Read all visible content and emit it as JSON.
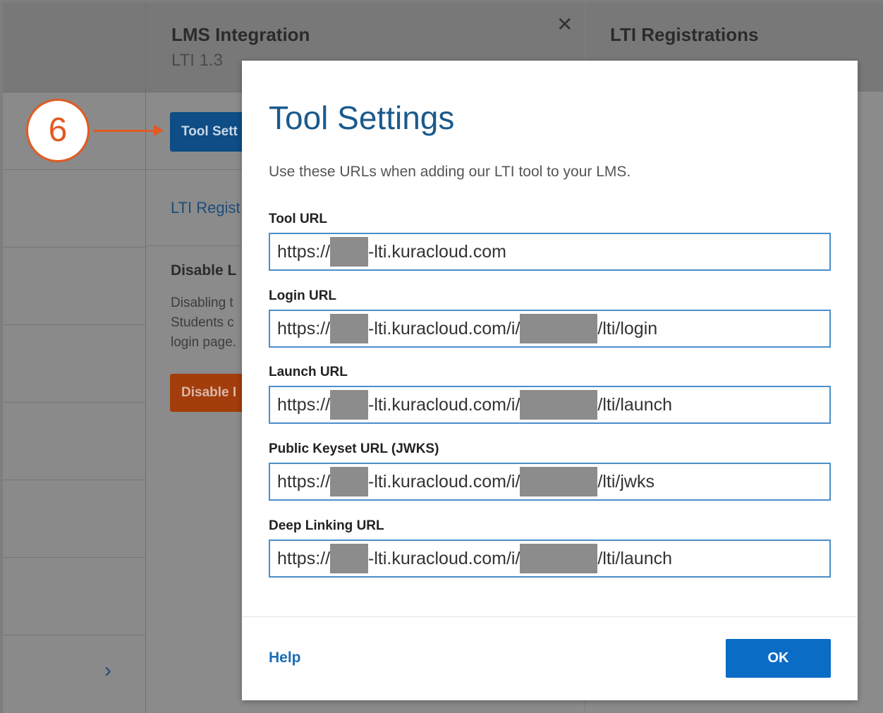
{
  "background": {
    "panel_title": "LMS Integration",
    "panel_subtitle": "LTI 1.3",
    "tool_button": "Tool Sett",
    "registrations_link": "LTI Regist",
    "disable_heading": "Disable L",
    "disable_desc": "Disabling t\nStudents c\nlogin page.",
    "disable_button": "Disable I",
    "right_title": "LTI Registrations",
    "close_glyph": "✕",
    "chevron_glyph": "›"
  },
  "annotation": {
    "step_number": "6",
    "accent_color": "#e05a22"
  },
  "modal": {
    "title": "Tool Settings",
    "intro": "Use these URLs when adding our LTI tool to your LMS.",
    "fields": [
      {
        "label": "Tool URL",
        "prefix": "https://",
        "middle": "-lti.kuracloud.com",
        "suffix": ""
      },
      {
        "label": "Login URL",
        "prefix": "https://",
        "middle": "-lti.kuracloud.com/i/",
        "suffix": "/lti/login"
      },
      {
        "label": "Launch URL",
        "prefix": "https://",
        "middle": "-lti.kuracloud.com/i/",
        "suffix": "/lti/launch"
      },
      {
        "label": "Public Keyset URL (JWKS)",
        "prefix": "https://",
        "middle": "-lti.kuracloud.com/i/",
        "suffix": "/lti/jwks"
      },
      {
        "label": "Deep Linking URL",
        "prefix": "https://",
        "middle": "-lti.kuracloud.com/i/",
        "suffix": "/lti/launch"
      }
    ],
    "help_label": "Help",
    "ok_label": "OK",
    "accent_color": "#0a6cc5"
  }
}
